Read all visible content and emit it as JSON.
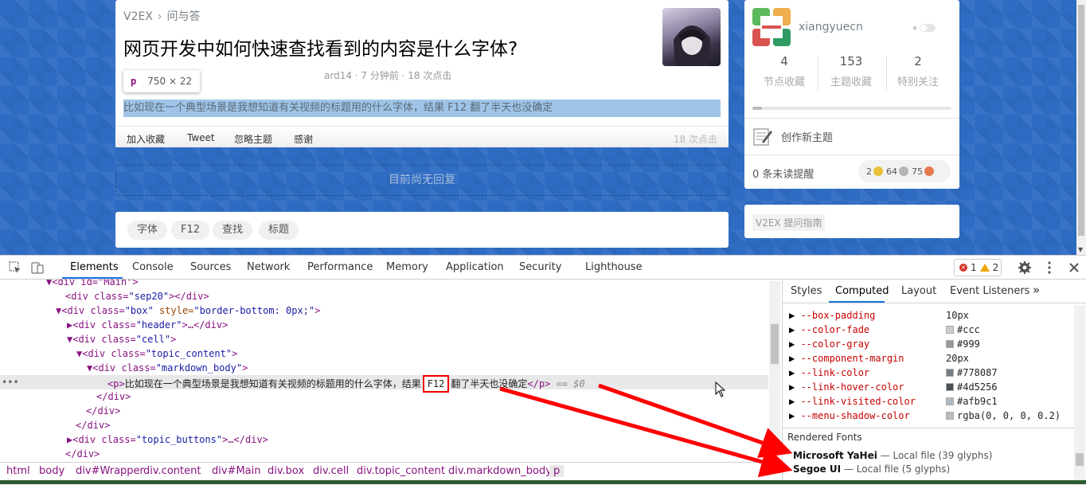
{
  "page": {
    "breadcrumb": [
      "V2EX",
      "问与答"
    ],
    "breadcrumb_sep": "›",
    "title": "网页开发中如何快速查找看到的内容是什么字体?",
    "meta": "ard14 · 7 分钟前 · 18 次点击",
    "tooltip": {
      "tag": "p",
      "size": "750 × 22"
    },
    "highlighted_text": "比如现在一个典型场景是我想知道有关视频的标题用的什么字体，结果 F12 翻了半天也没确定",
    "actions": [
      "加入收藏",
      "Tweet",
      "忽略主题",
      "感谢"
    ],
    "action_count": "18 次点击",
    "no_reply": "目前尚无回复",
    "tags": [
      "字体",
      "F12",
      "查找",
      "标题"
    ]
  },
  "sidebar": {
    "username": "xiangyuecn",
    "stats": [
      {
        "value": "4",
        "label": "节点收藏"
      },
      {
        "value": "153",
        "label": "主题收藏"
      },
      {
        "value": "2",
        "label": "特别关注"
      }
    ],
    "create_label": "创作新主题",
    "unread": "0 条未读提醒",
    "coins": [
      "2",
      "64",
      "75"
    ],
    "guide": "V2EX 提问指南"
  },
  "devtools": {
    "tabs": [
      "Elements",
      "Console",
      "Sources",
      "Network",
      "Performance",
      "Memory",
      "Application",
      "Security",
      "Lighthouse"
    ],
    "active_tab": "Elements",
    "issues_errors": "1",
    "issues_warnings": "2",
    "dom": {
      "l0": "▼<div id=\"Main\">",
      "l1a": "<div class=",
      "l1b": "\"sep20\"",
      "l1c": "></div>",
      "l2a": "▼<div class=",
      "l2b": "\"box\"",
      "l2c": " style=",
      "l2d": "\"border-bottom: 0px;\"",
      "l2e": ">",
      "l3a": "▶<div class=",
      "l3b": "\"header\"",
      "l3c": ">…</div>",
      "l4a": "▼<div class=",
      "l4b": "\"cell\"",
      "l4c": ">",
      "l5a": "▼<div class=",
      "l5b": "\"topic_content\"",
      "l5c": ">",
      "l6a": "▼<div class=",
      "l6b": "\"markdown_body\"",
      "l6c": ">",
      "p_open": "<p>",
      "p_text1": "比如现在一个典型场景是我想知道有关视频的标题用的什么字体，结果",
      "p_f12": "F12",
      "p_text2": "翻了半天也没确定",
      "p_close": "</p>",
      "p_eq": " == $0",
      "c1": "</div>",
      "c2": "</div>",
      "c3": "</div>",
      "l10a": "▶<div class=",
      "l10b": "\"topic_buttons\"",
      "l10c": ">…</div>",
      "c4": "</div>"
    },
    "breadcrumbs": [
      "html",
      "body",
      "div#Wrapper",
      "div.content",
      "div#Main",
      "div.box",
      "div.cell",
      "div.topic_content",
      "div.markdown_body",
      "p"
    ],
    "right_tabs": [
      "Styles",
      "Computed",
      "Layout",
      "Event Listeners"
    ],
    "right_active": "Computed",
    "computed": [
      {
        "name": "--box-padding",
        "value": "10px",
        "swatch": ""
      },
      {
        "name": "--color-fade",
        "value": "#ccc",
        "swatch": "#cccccc"
      },
      {
        "name": "--color-gray",
        "value": "#999",
        "swatch": "#999999"
      },
      {
        "name": "--component-margin",
        "value": "20px",
        "swatch": ""
      },
      {
        "name": "--link-color",
        "value": "#778087",
        "swatch": "#778087"
      },
      {
        "name": "--link-hover-color",
        "value": "#4d5256",
        "swatch": "#4d5256"
      },
      {
        "name": "--link-visited-color",
        "value": "#afb9c1",
        "swatch": "#afb9c1"
      },
      {
        "name": "--menu-shadow-color",
        "value": "rgba(0, 0, 0, 0.2)",
        "swatch": "#bbbbbb"
      }
    ],
    "rendered_fonts_header": "Rendered Fonts",
    "fonts": [
      {
        "name": "Microsoft YaHei",
        "detail": "— Local file (39 glyphs)"
      },
      {
        "name": "Segoe UI",
        "detail": "— Local file (5 glyphs)"
      }
    ]
  },
  "colors": {
    "accent": "#1a73e8",
    "annotation": "#ff0000",
    "page_bg": "#2e6cc4"
  }
}
